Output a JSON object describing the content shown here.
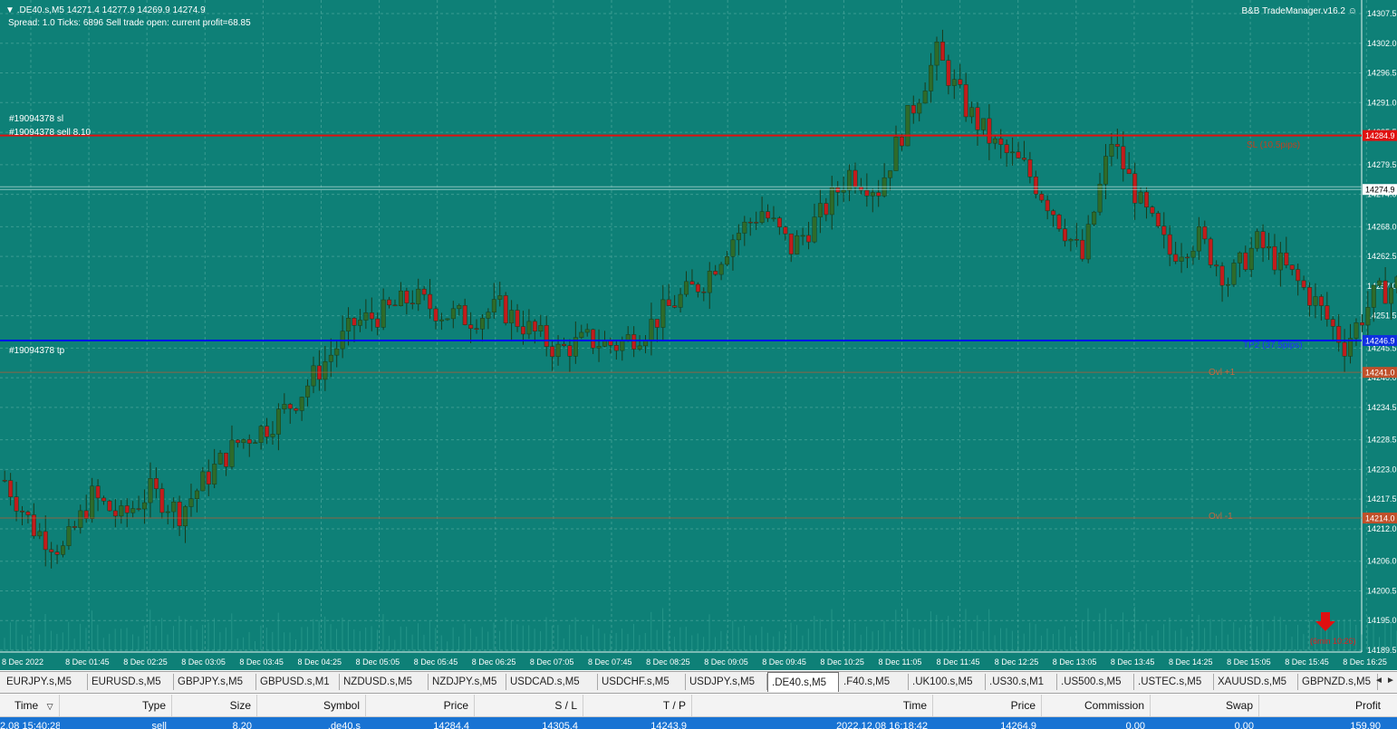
{
  "chart": {
    "header_line1": ".DE40.s,M5  14271.4 14277.9 14269.9 14274.9",
    "header_line2": "Spread: 1.0   Ticks: 6896   Sell trade open: current profit=68.85",
    "trade_manager": "B&B TradeManager.v16.2",
    "label_sl": "#19094378 sl",
    "label_sell": "#19094378 sell 8.10",
    "label_tp": "#19094378 tp",
    "tp2_text": "TP2 (37.5pips)",
    "sl_text": "SL (10.5pips)",
    "ovl_plus1": "Ovl +1",
    "ovl_minus1": "Ovl -1",
    "timer_text": "(6min 10:26)",
    "price_ticks": [
      "14307.5",
      "14302.0",
      "14296.5",
      "14291.0",
      "14285.5",
      "14279.5",
      "14274.0",
      "14268.0",
      "14262.5",
      "14257.0",
      "14251.5",
      "14245.5",
      "14240.0",
      "14234.5",
      "14228.5",
      "14223.0",
      "14217.5",
      "14212.0",
      "14206.0",
      "14200.5",
      "14195.0",
      "14189.5"
    ],
    "price_tags": {
      "sell": "14284.9",
      "current": "14274.9",
      "tp": "14246.9",
      "ovl_plus1": "14241.0",
      "ovl_minus1": "14214.0"
    },
    "time_labels": [
      "8 Dec 2022",
      "8 Dec 01:45",
      "8 Dec 02:25",
      "8 Dec 03:05",
      "8 Dec 03:45",
      "8 Dec 04:25",
      "8 Dec 05:05",
      "8 Dec 05:45",
      "8 Dec 06:25",
      "8 Dec 07:05",
      "8 Dec 07:45",
      "8 Dec 08:25",
      "8 Dec 09:05",
      "8 Dec 09:45",
      "8 Dec 10:25",
      "8 Dec 11:05",
      "8 Dec 11:45",
      "8 Dec 12:25",
      "8 Dec 13:05",
      "8 Dec 13:45",
      "8 Dec 14:25",
      "8 Dec 15:05",
      "8 Dec 15:45",
      "8 Dec 16:25"
    ],
    "colors": {
      "background": "#0e8077",
      "bull": "#2e6b2a",
      "bear": "#c21c1c",
      "sell_line": "#e01010",
      "tp_line": "#0010ee",
      "ovl_line": "#c05a30",
      "volume": "#3fae9e"
    },
    "price_range": [
      14189.5,
      14307.5
    ]
  },
  "chart_data": {
    "type": "candlestick",
    "symbol": ".DE40.s",
    "timeframe": "M5",
    "ylim": [
      14189.5,
      14307.5
    ],
    "x_labels": [
      "8 Dec 2022",
      "8 Dec 01:45",
      "8 Dec 02:25",
      "8 Dec 03:05",
      "8 Dec 03:45",
      "8 Dec 04:25",
      "8 Dec 05:05",
      "8 Dec 05:45",
      "8 Dec 06:25",
      "8 Dec 07:05",
      "8 Dec 07:45",
      "8 Dec 08:25",
      "8 Dec 09:05",
      "8 Dec 09:45",
      "8 Dec 10:25",
      "8 Dec 11:05",
      "8 Dec 11:45",
      "8 Dec 12:25",
      "8 Dec 13:05",
      "8 Dec 13:45",
      "8 Dec 14:25",
      "8 Dec 15:05",
      "8 Dec 15:45",
      "8 Dec 16:25"
    ],
    "close_path": [
      14221,
      14212,
      14208,
      14218,
      14214,
      14219,
      14215,
      14222,
      14228,
      14231,
      14236,
      14243,
      14250,
      14252,
      14255,
      14252,
      14251,
      14253,
      14249,
      14245,
      14247,
      14246,
      14249,
      14254,
      14258,
      14266,
      14271,
      14264,
      14270,
      14278,
      14275,
      14288,
      14300,
      14290,
      14283,
      14279,
      14271,
      14262,
      14284,
      14272,
      14263,
      14266,
      14258,
      14265,
      14260,
      14254,
      14246,
      14255,
      14258,
      14250,
      14244,
      14236,
      14224,
      14213,
      14210,
      14218,
      14211,
      14206,
      14219,
      14213,
      14203,
      14226,
      14228,
      14238,
      14244,
      14240,
      14244,
      14239,
      14236,
      14246,
      14262,
      14242,
      14233,
      14220,
      14214,
      14214,
      14224,
      14217,
      14212,
      14246,
      14258,
      14268,
      14280,
      14282,
      14286,
      14281,
      14276,
      14266,
      14262,
      14268,
      14274
    ],
    "sell_price": 14284.9,
    "current_price": 14274.9,
    "tp_price": 14246.9,
    "ovl_plus1": 14241.0,
    "ovl_minus1": 14214.0
  },
  "tabs": {
    "items": [
      "EURJPY.s,M5",
      "EURUSD.s,M5",
      "GBPJPY.s,M5",
      "GBPUSD.s,M1",
      "NZDUSD.s,M5",
      "NZDJPY.s,M5",
      "USDCAD.s,M5",
      "USDCHF.s,M5",
      "USDJPY.s,M5",
      ".DE40.s,M5",
      ".F40.s,M5",
      ".UK100.s,M5",
      ".US30.s,M1",
      ".US500.s,M5",
      ".USTEC.s,M5",
      "XAUUSD.s,M5",
      "GBPNZD.s,M5"
    ],
    "active_index": 9,
    "nav_prev": "◄",
    "nav_next": "►"
  },
  "table": {
    "headers": {
      "time": "Time",
      "sort": "▽",
      "type": "Type",
      "size": "Size",
      "symbol": "Symbol",
      "price": "Price",
      "sl": "S / L",
      "tp": "T / P",
      "time2": "Time",
      "price2": "Price",
      "commission": "Commission",
      "swap": "Swap",
      "profit": "Profit"
    },
    "row": {
      "time": "2.08 15:40:28",
      "type": "sell",
      "size": "8.20",
      "symbol": ".de40.s",
      "price": "14284.4",
      "sl": "14305.4",
      "tp": "14243.9",
      "time2": "2022.12.08 16:18:42",
      "price2": "14264.9",
      "commission": "0.00",
      "swap": "0.00",
      "profit": "159.90"
    }
  }
}
